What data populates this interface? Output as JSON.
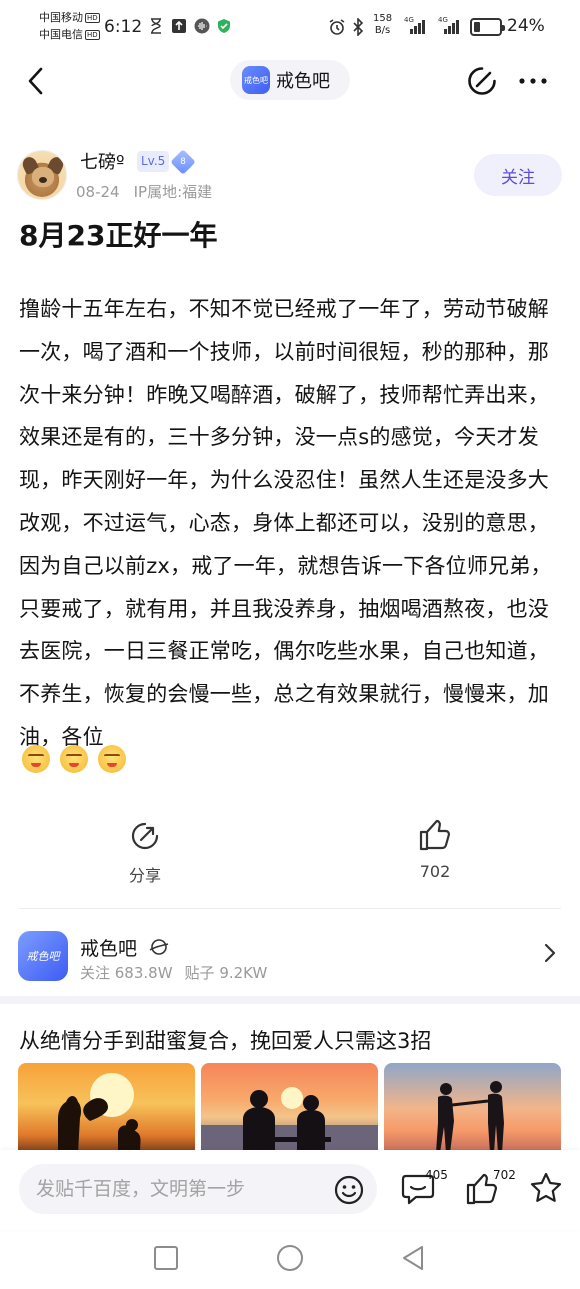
{
  "status_bar": {
    "carrier_1": "中国移动",
    "carrier_2": "中国电信",
    "hd_label": "HD",
    "time": "6:12",
    "net_speed_value": "158",
    "net_speed_unit": "B/s",
    "signal_label": "4G",
    "battery_percent": "24%",
    "battery_level": 0.24,
    "icons": [
      "hourglass-icon",
      "upload-icon",
      "audio-icon",
      "shield-check-icon",
      "alarm-icon",
      "bluetooth-icon",
      "signal-icon",
      "battery-icon"
    ]
  },
  "header": {
    "forum_name": "戒色吧",
    "forum_logo_text": "戒色吧",
    "icons": [
      "back-icon",
      "edit-icon",
      "more-icon"
    ]
  },
  "author": {
    "name": "七磅º",
    "level": "Lv.5",
    "level_gem": "8",
    "date": "08-24",
    "ip_location": "IP属地:福建",
    "follow_label": "关注"
  },
  "post": {
    "title": "8月23正好一年",
    "body": "撸龄十五年左右，不知不觉已经戒了一年了，劳动节破解一次，喝了酒和一个技师，以前时间很短，秒的那种，那次十来分钟！昨晚又喝醉酒，破解了，技师帮忙弄出来，效果还是有的，三十多分钟，没一点s的感觉，今天才发现，昨天刚好一年，为什么没忍住！虽然人生还是没多大改观，不过运气，心态，身体上都还可以，没别的意思，因为自己以前zx，戒了一年，就想告诉一下各位师兄弟，只要戒了，就有用，并且我没养身，抽烟喝酒熬夜，也没去医院，一日三餐正常吃，偶尔吃些水果，自己也知道，不养生，恢复的会慢一些，总之有效果就行，慢慢来，加油，各位",
    "emoji_count": 3,
    "emoji_icon": "annoyed-face-icon"
  },
  "actions": {
    "share_label": "分享",
    "like_count": "702"
  },
  "forum_card": {
    "name": "戒色吧",
    "logo_text": "戒色吧",
    "followers": "关注 683.8W",
    "posts": "贴子 9.2KW"
  },
  "recommendation": {
    "title": "从绝情分手到甜蜜复合，挽回爱人只需这3招"
  },
  "bottom_bar": {
    "reply_placeholder": "发贴千百度，文明第一步",
    "comment_count": "405",
    "like_count": "702"
  },
  "colors": {
    "accent": "#5b4fd8",
    "follow_bg": "#f0effc",
    "level_badge_bg": "#e9ecff",
    "muted_text": "#9a9a9a"
  }
}
